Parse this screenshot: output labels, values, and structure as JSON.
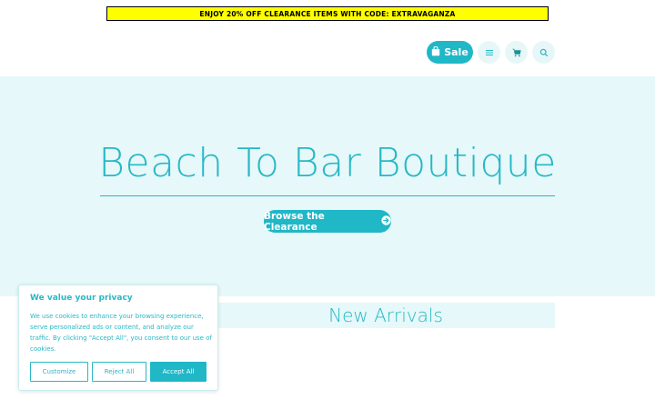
{
  "promo_bar": {
    "text": "ENJOY 20% OFF CLEARANCE ITEMS WITH CODE: EXTRAVAGANZA"
  },
  "header": {
    "sale_label": "Sale",
    "icons": [
      "shopping-bag-icon",
      "hamburger-menu-icon",
      "cart-icon",
      "search-icon"
    ]
  },
  "hero": {
    "title": "Beach To Bar Boutique",
    "button_label": "Browse the Clearance"
  },
  "section": {
    "title": "New Arrivals"
  },
  "cookie_banner": {
    "title": "We value your privacy",
    "body": "We use cookies to enhance your browsing experience, serve personalized ads or content, and analyze our traffic. By clicking \"Accept All\", you consent to our use of cookies.",
    "buttons": {
      "customize": "Customize",
      "reject": "Reject All",
      "accept": "Accept All"
    }
  },
  "colors": {
    "accent": "#20b7c7",
    "hero_bg": "#e6f8f9",
    "promo_bg": "#ffff00"
  }
}
